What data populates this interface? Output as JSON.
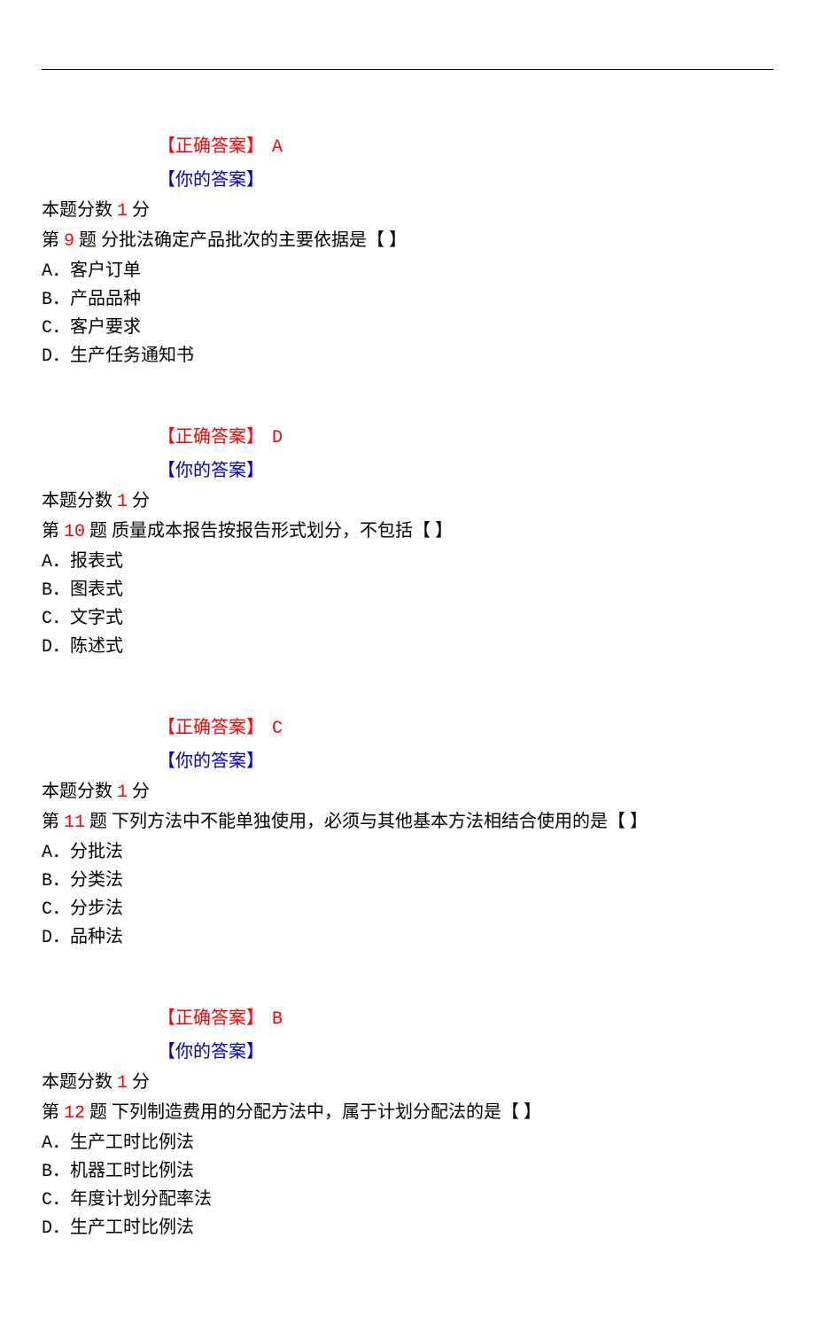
{
  "labels": {
    "correct_answer": "【正确答案】",
    "your_answer": "【你的答案】",
    "score_prefix": "本题分数",
    "score_suffix": "分",
    "q_prefix": "第",
    "q_suffix": "题"
  },
  "blocks": [
    {
      "correct": "A",
      "score": "1",
      "next_q": {
        "num": "9",
        "stem": "分批法确定产品批次的主要依据是【 】",
        "opts": [
          "A．客户订单",
          "B．产品品种",
          "C．客户要求",
          "D．生产任务通知书"
        ]
      }
    },
    {
      "correct": "D",
      "score": "1",
      "next_q": {
        "num": "10",
        "stem": "质量成本报告按报告形式划分，不包括【 】",
        "opts": [
          "A．报表式",
          "B．图表式",
          "C．文字式",
          "D．陈述式"
        ]
      }
    },
    {
      "correct": "C",
      "score": "1",
      "next_q": {
        "num": "11",
        "stem": "下列方法中不能单独使用，必须与其他基本方法相结合使用的是【 】",
        "opts": [
          "A．分批法",
          "B．分类法",
          "C．分步法",
          "D．品种法"
        ]
      }
    },
    {
      "correct": "B",
      "score": "1",
      "next_q": {
        "num": "12",
        "stem": "下列制造费用的分配方法中，属于计划分配法的是【 】",
        "opts": [
          "A．生产工时比例法",
          "B．机器工时比例法",
          "C．年度计划分配率法",
          "D．生产工时比例法"
        ]
      }
    }
  ]
}
